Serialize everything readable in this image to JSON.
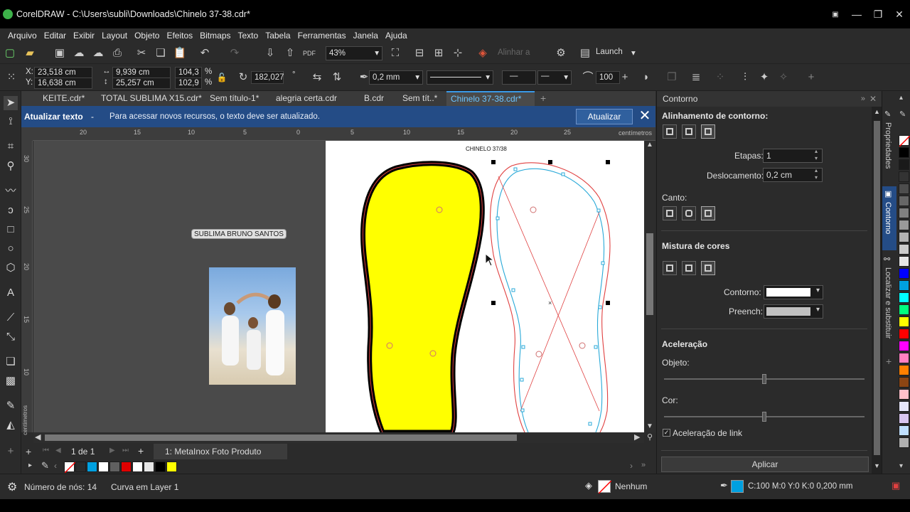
{
  "window": {
    "title": "CorelDRAW - C:\\Users\\subli\\Downloads\\Chinelo 37-38.cdr*"
  },
  "menu": [
    "Arquivo",
    "Editar",
    "Exibir",
    "Layout",
    "Objeto",
    "Efeitos",
    "Bitmaps",
    "Texto",
    "Tabela",
    "Ferramentas",
    "Janela",
    "Ajuda"
  ],
  "toolbar": {
    "zoom": "43%",
    "align_label": "Alinhar a",
    "launch_label": "Launch"
  },
  "propbar": {
    "x": "23,518 cm",
    "y": "16,638 cm",
    "width": "9,939 cm",
    "height": "25,257 cm",
    "scale_w": "104,3",
    "scale_h": "102,9",
    "pct1": "%",
    "pct2": "%",
    "x_label": "X:",
    "y_label": "Y:",
    "rotation": "182,027",
    "rotation_unit": "°",
    "outline_width": "0,2 mm",
    "smoothing": "100"
  },
  "tabs": [
    "KEITE.cdr*",
    "TOTAL SUBLIMA X15.cdr*",
    "Sem título-1*",
    "alegria certa.cdr",
    "B.cdr",
    "Sem tít..*",
    "Chinelo 37-38.cdr*"
  ],
  "notification": {
    "title": "Atualizar texto",
    "dash": "-",
    "message": "Para acessar novos recursos, o texto deve ser atualizado.",
    "button": "Atualizar"
  },
  "ruler": {
    "h_ticks": [
      "20",
      "15",
      "10",
      "5",
      "0",
      "5",
      "10",
      "15",
      "20",
      "25"
    ],
    "v_ticks": [
      "30",
      "25",
      "20",
      "15",
      "10"
    ],
    "unit": "centímetros",
    "v_unit": "centímetros"
  },
  "canvas": {
    "page_label": "CHINELO 37/38",
    "text_object": "SUBLIMA BRUNO SANTOS"
  },
  "pagenav": {
    "page_count": "1 de 1",
    "page_name": "1: MetaInox Foto Produto"
  },
  "docker": {
    "title": "Contorno",
    "align_section": "Alinhamento de contorno:",
    "etapas_label": "Etapas:",
    "etapas_value": "1",
    "deslocamento_label": "Deslocamento:",
    "deslocamento_value": "0,2 cm",
    "canto_label": "Canto:",
    "mistura_section": "Mistura de cores",
    "contorno_label": "Contorno:",
    "preench_label": "Preench:",
    "aceleracao_section": "Aceleração",
    "objeto_label": "Objeto:",
    "cor_label": "Cor:",
    "link_label": "Aceleração de link",
    "apply_button": "Aplicar",
    "slider_objeto": 0.5,
    "slider_cor": 0.5
  },
  "sidetabs": [
    "Propriedades",
    "Contorno",
    "Localizar e substituir"
  ],
  "status": {
    "nodes": "Número de nós: 14",
    "object": "Curva em Layer 1",
    "fill": "Nenhum",
    "outline": "C:100 M:0 Y:0 K:0  0,200 mm"
  },
  "colors": {
    "accent": "#3a9ae8",
    "notify_bg": "#244c86",
    "sole_fill": "#ffff00",
    "contour_red": "#e04040",
    "contour_cyan": "#29a9d8"
  },
  "palette_right": [
    "#ffffff",
    "#000000",
    "#1a1a1a",
    "#333333",
    "#4d4d4d",
    "#666666",
    "#808080",
    "#999999",
    "#b3b3b3",
    "#cccccc",
    "#e6e6e6",
    "#0000ff",
    "#00a0e0",
    "#00ffff",
    "#00ff80",
    "#ffff00",
    "#ff0000",
    "#ff00ff",
    "#ff80c0",
    "#ff8000",
    "#8b4513",
    "#ffc0cb",
    "#e6e6fa",
    "#d9c6f0",
    "#c0e0ff",
    "#b0b0b0"
  ],
  "palette_bottom": [
    "#00a0e0",
    "#ffffff",
    "#606060",
    "#e00000",
    "#ffffff",
    "#e6e6e6",
    "#000000",
    "#ffff00"
  ]
}
